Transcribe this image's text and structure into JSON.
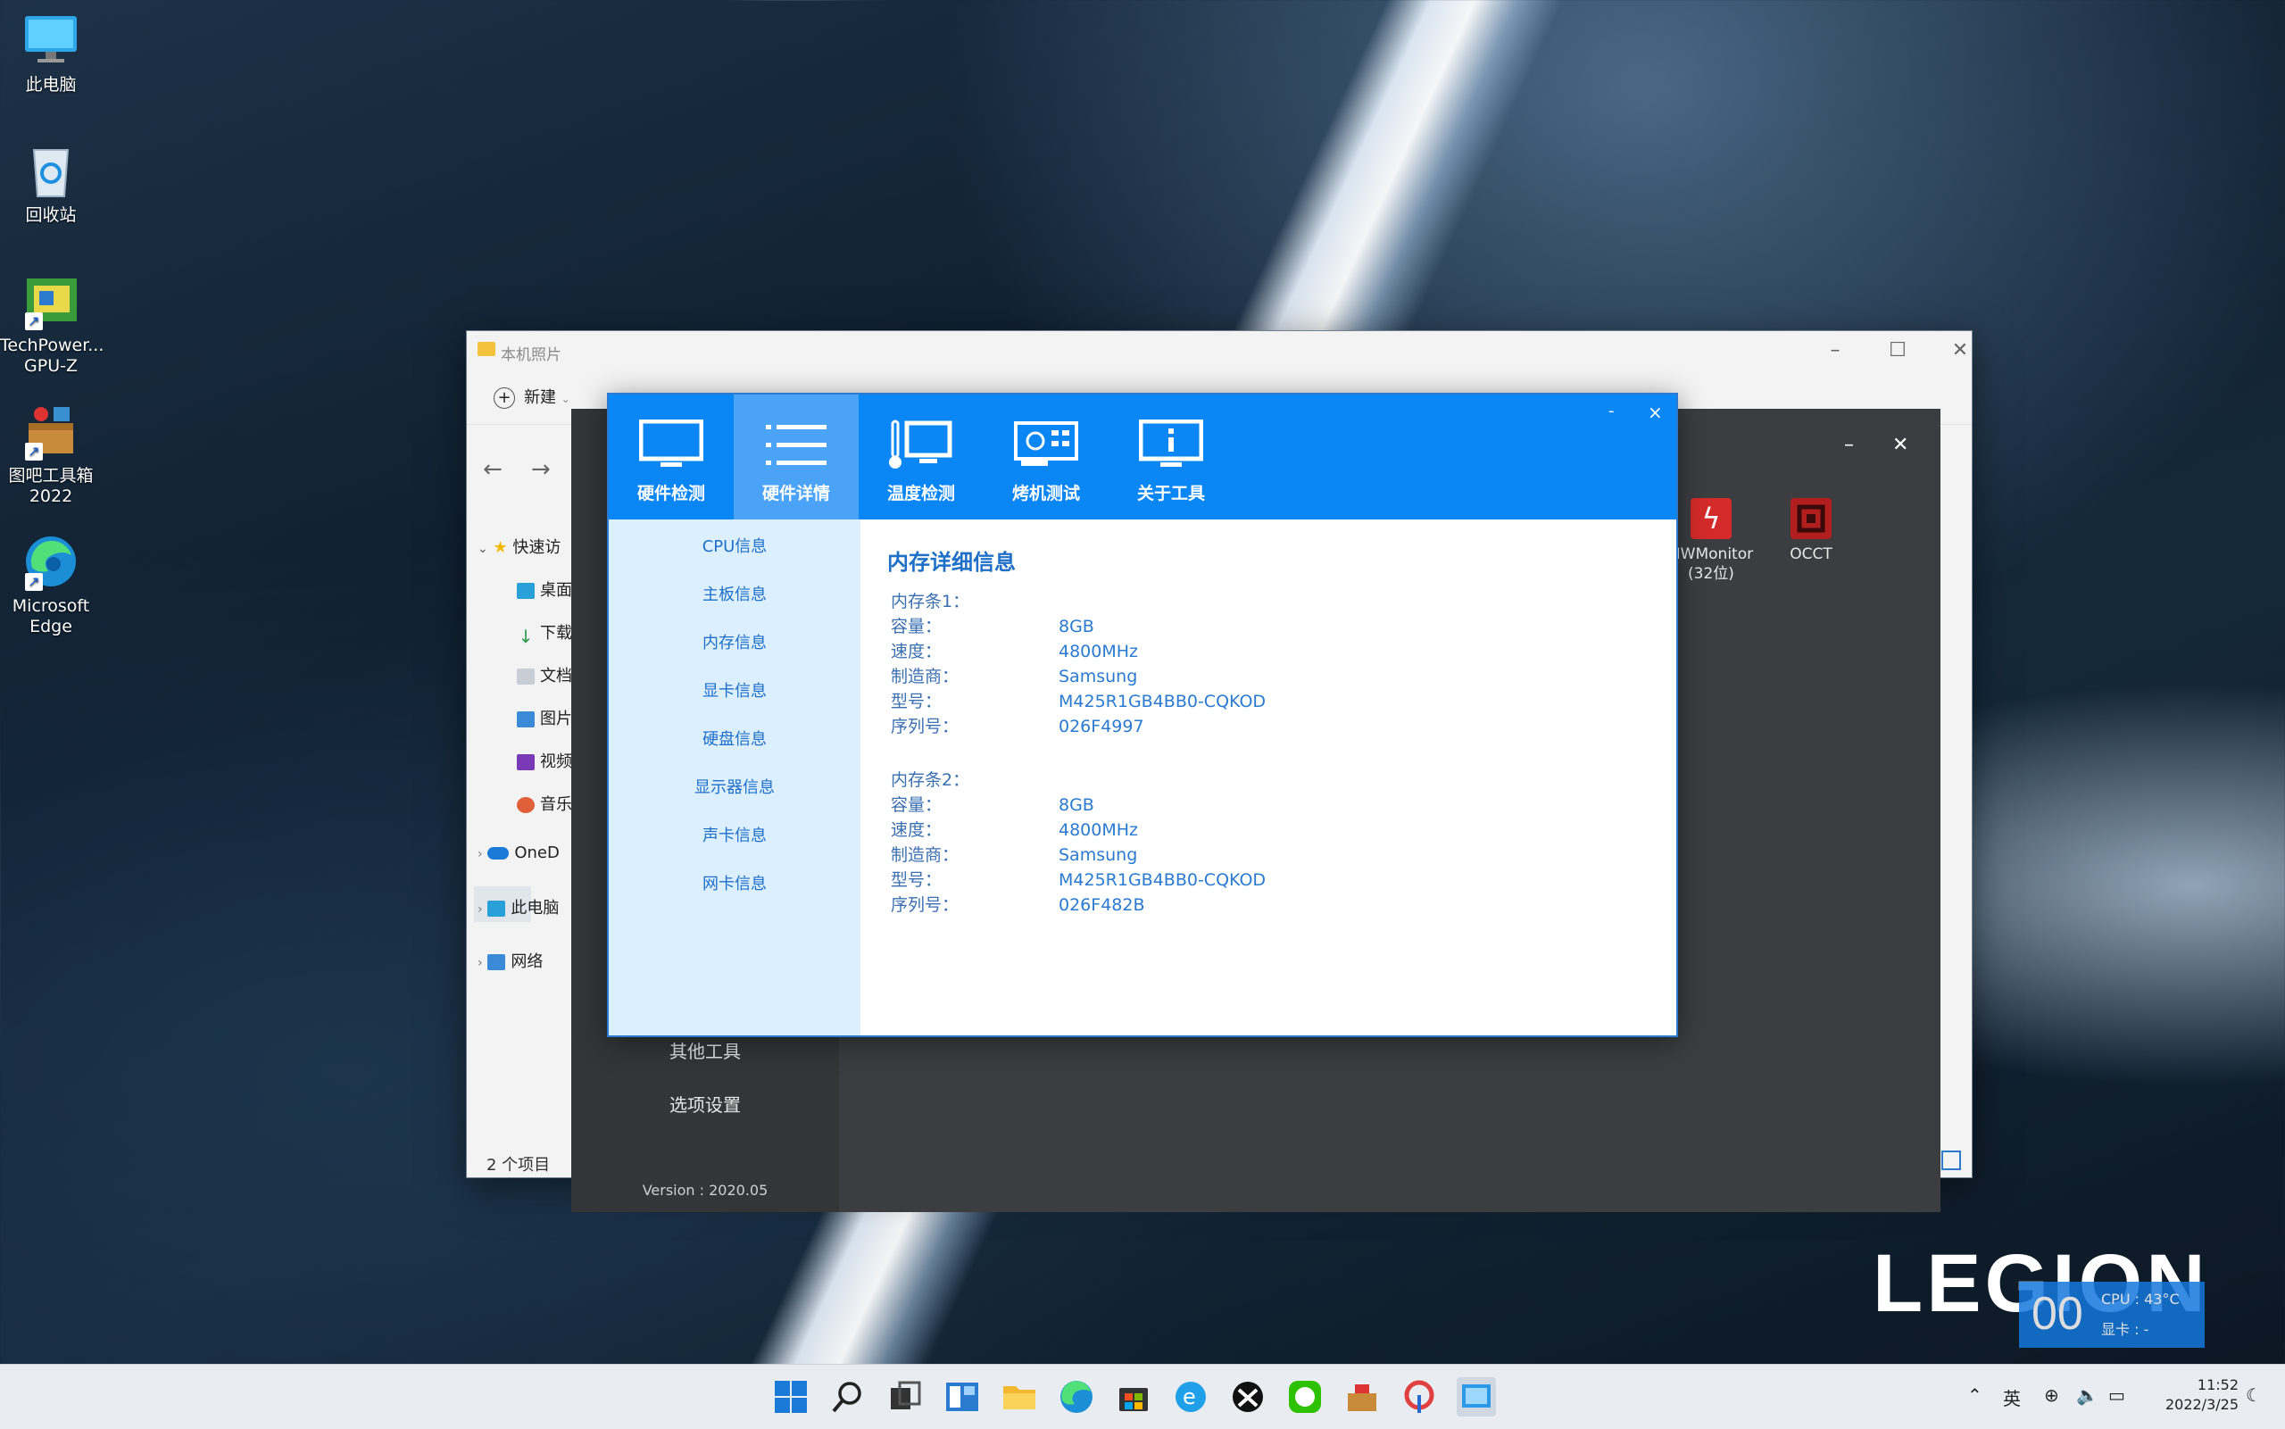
{
  "desktop": {
    "icons": [
      {
        "label": "此电脑",
        "icon": "computer-icon"
      },
      {
        "label": "回收站",
        "icon": "recycle-bin-icon"
      },
      {
        "label": "TechPower...\nGPU-Z",
        "line1": "TechPower...",
        "line2": "GPU-Z",
        "icon": "gpuz-icon"
      },
      {
        "line1": "图吧工具箱",
        "line2": "2022",
        "icon": "toolbox-icon"
      },
      {
        "line1": "Microsoft",
        "line2": "Edge",
        "icon": "edge-icon"
      }
    ]
  },
  "explorer": {
    "title": "本机照片",
    "new_label": "新建",
    "nav": {
      "quick_access": "快速访",
      "desktop": "桌面",
      "downloads": "下载",
      "documents": "文档",
      "pictures": "图片",
      "videos": "视频",
      "music": "音乐",
      "onedrive": "OneD",
      "this_pc": "此电脑",
      "network": "网络"
    },
    "status": "2 个项目"
  },
  "dark_window": {
    "side_items": [
      "其他工具",
      "选项设置"
    ],
    "version": "Version : 2020.05",
    "apps": [
      {
        "line1": "HWMonitor",
        "line2": "(32位)",
        "icon": "hwmonitor-icon",
        "color": "#d42a2a"
      },
      {
        "line1": "OCCT",
        "line2": "",
        "icon": "occt-icon",
        "color": "#b01e1e"
      }
    ]
  },
  "app": {
    "tabs": [
      {
        "label": "硬件检测",
        "icon": "monitor-icon"
      },
      {
        "label": "硬件详情",
        "icon": "list-icon",
        "active": true
      },
      {
        "label": "温度检测",
        "icon": "thermometer-icon"
      },
      {
        "label": "烤机测试",
        "icon": "gpu-card-icon"
      },
      {
        "label": "关于工具",
        "icon": "info-icon"
      }
    ],
    "minimize": "-",
    "close": "×",
    "side_items": [
      "CPU信息",
      "主板信息",
      "内存信息",
      "显卡信息",
      "硬盘信息",
      "显示器信息",
      "声卡信息",
      "网卡信息"
    ],
    "content": {
      "title": "内存详细信息",
      "modules": [
        {
          "header": "内存条1：",
          "rows": [
            {
              "k": "容量：",
              "v": "8GB"
            },
            {
              "k": "速度：",
              "v": "4800MHz"
            },
            {
              "k": "制造商：",
              "v": "Samsung"
            },
            {
              "k": "型号：",
              "v": "M425R1GB4BB0-CQKOD"
            },
            {
              "k": "序列号：",
              "v": "026F4997"
            }
          ]
        },
        {
          "header": "内存条2：",
          "rows": [
            {
              "k": "容量：",
              "v": "8GB"
            },
            {
              "k": "速度：",
              "v": "4800MHz"
            },
            {
              "k": "制造商：",
              "v": "Samsung"
            },
            {
              "k": "型号：",
              "v": "M425R1GB4BB0-CQKOD"
            },
            {
              "k": "序列号：",
              "v": "026F482B"
            }
          ]
        }
      ]
    }
  },
  "overlay": {
    "logo": "LEGION",
    "fps": "00",
    "cpu": "CPU : 43°C",
    "gpu": "显卡 : -"
  },
  "taskbar": {
    "apps": [
      "start-icon",
      "search-icon",
      "task-view-icon",
      "widgets-icon",
      "file-explorer-icon",
      "edge-icon",
      "store-icon",
      "ie-icon",
      "xbox-icon",
      "wechat-icon",
      "toolbox-icon",
      "pinwheel-icon",
      "app-icon"
    ],
    "ime": "英",
    "time": "11:52",
    "date": "2022/3/25"
  },
  "colors": {
    "accent": "#0a86f5",
    "tab_active": "#4aa3f7",
    "side_bg": "#dcefff",
    "link_text": "#1e6fc8"
  }
}
